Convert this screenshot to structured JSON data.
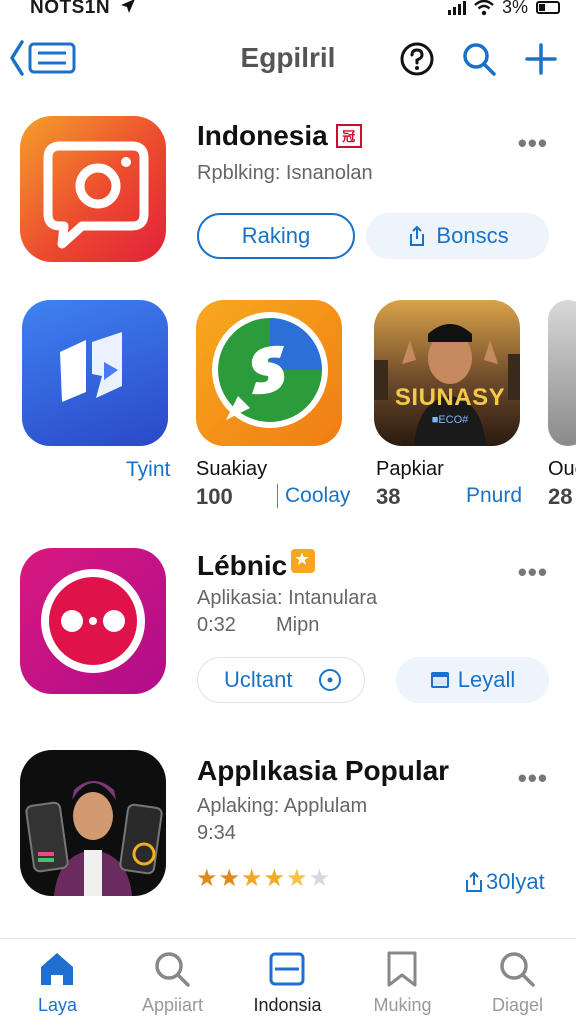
{
  "status": {
    "carrier": "NOTS1N",
    "battery": "3%"
  },
  "nav": {
    "title": "Egpilril"
  },
  "app1": {
    "name": "Indonesia",
    "badge": "冠",
    "subtitle": "Rpblking: Isnanolan",
    "btn_primary": "Raking",
    "btn_secondary": "Bonscs"
  },
  "tiles": [
    {
      "link": "Tyint"
    },
    {
      "name": "Suakiay",
      "num": "100",
      "link": "Coolay"
    },
    {
      "name": "Papkiar",
      "num": "38",
      "link": "Pnurd",
      "banner": "SIUNASY",
      "banner_sub": "■ECO#"
    },
    {
      "name": "Oue",
      "num": "28"
    }
  ],
  "app2": {
    "name": "Lébnic",
    "subtitle": "Aplikasia: Intanulara",
    "time": "0:32",
    "extra": "Mipn",
    "btn_primary": "Ucltant",
    "btn_secondary": "Leyall"
  },
  "app3": {
    "name": "Applıkasia Popular",
    "subtitle": "Aplaking: Applulam",
    "time": "9:34",
    "rating": 4.5,
    "count": "30lyat"
  },
  "tabs": [
    {
      "label": "Laya",
      "icon": "home-icon",
      "active": true
    },
    {
      "label": "Appiiart",
      "icon": "search-icon"
    },
    {
      "label": "Indonsia",
      "icon": "window-icon"
    },
    {
      "label": "Muking",
      "icon": "bookmark-icon"
    },
    {
      "label": "Diagel",
      "icon": "search-icon"
    }
  ],
  "colors": {
    "accent": "#1a72c7",
    "active_tab": "#1f6fd0"
  }
}
